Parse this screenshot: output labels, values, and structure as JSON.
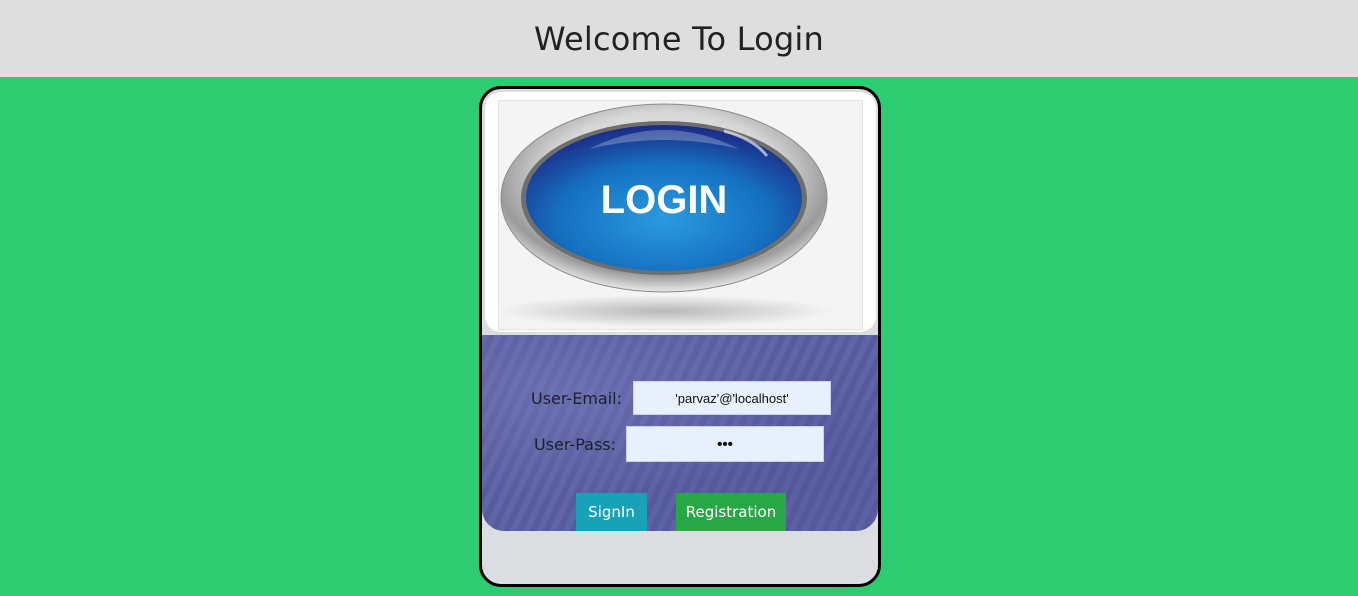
{
  "header": {
    "title": "Welcome To Login"
  },
  "logo": {
    "text": "LOGIN"
  },
  "form": {
    "email_label": "User-Email:",
    "email_value": "'parvaz'@'localhost'",
    "pass_label": "User-Pass:",
    "pass_value": "•••",
    "signin_label": "SignIn",
    "registration_label": "Registration"
  },
  "colors": {
    "background": "#2ecc71",
    "header_bg": "#dedede",
    "signin_button": "#17a2b8",
    "registration_button": "#28a745",
    "form_panel": "#5a5fa3"
  }
}
